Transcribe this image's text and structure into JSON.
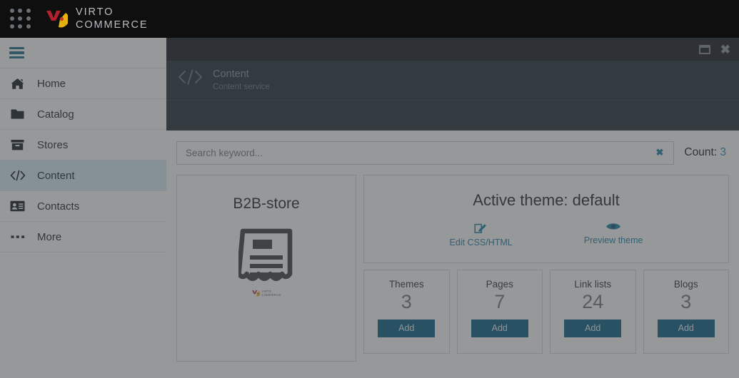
{
  "topbar": {
    "apps_grid_icon": "grid-dots-icon",
    "logo_icon": "virto-logo-icon",
    "brand_line1": "VIRTO",
    "brand_line2": "COMMERCE"
  },
  "sidebar": {
    "menu_toggle_icon": "hamburger-icon",
    "items": [
      {
        "label": "Home",
        "icon": "home-icon",
        "active": false
      },
      {
        "label": "Catalog",
        "icon": "folder-icon",
        "active": false
      },
      {
        "label": "Stores",
        "icon": "archive-box-icon",
        "active": false
      },
      {
        "label": "Content",
        "icon": "code-brackets-icon",
        "active": true
      },
      {
        "label": "Contacts",
        "icon": "contact-card-icon",
        "active": false
      },
      {
        "label": "More",
        "icon": "ellipsis-icon",
        "active": false
      }
    ]
  },
  "blade": {
    "window_restore_icon": "window-restore-icon",
    "window_close_icon": "close-icon",
    "header_icon": "code-brackets-icon",
    "title": "Content",
    "subtitle": "Content service"
  },
  "search": {
    "placeholder": "Search keyword...",
    "value": "",
    "clear_icon": "clear-x-icon",
    "count_label": "Count:",
    "count_value": "3"
  },
  "store_card": {
    "name": "B2B-store",
    "thumbnail_icon": "document-receipt-icon",
    "watermark_line1": "VIRTO",
    "watermark_line2": "COMMERCE"
  },
  "theme": {
    "title": "Active theme: default",
    "actions": [
      {
        "label": "Edit CSS/HTML",
        "icon": "edit-pencil-icon"
      },
      {
        "label": "Preview theme",
        "icon": "eye-icon"
      }
    ]
  },
  "stats": [
    {
      "label": "Themes",
      "value": "3",
      "button": "Add"
    },
    {
      "label": "Pages",
      "value": "7",
      "button": "Add"
    },
    {
      "label": "Link lists",
      "value": "24",
      "button": "Add"
    },
    {
      "label": "Blogs",
      "value": "3",
      "button": "Add"
    }
  ],
  "colors": {
    "accent_blue": "#1b7fa8",
    "button_teal": "#046184",
    "active_nav": "#d5effb",
    "topbar_bg": "#100f0f",
    "blade_header_bg": "#1c2a35",
    "logo_red": "#b3202b",
    "logo_gold": "#e5b40c"
  }
}
